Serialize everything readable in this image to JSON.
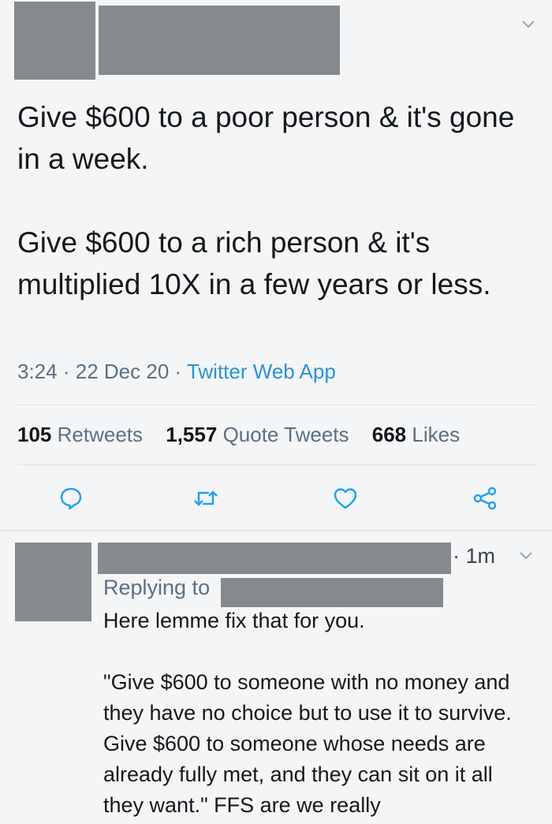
{
  "tweet": {
    "paragraphs": [
      "Give $600 to a poor person & it's gone in a week.",
      "Give $600 to a rich person & it's multiplied 10X in a few years or less."
    ],
    "time": "3:24",
    "date": "22 Dec 20",
    "source": "Twitter Web App",
    "dot": "·",
    "stats": {
      "retweets_count": "105",
      "retweets_label": "Retweets",
      "quotes_count": "1,557",
      "quotes_label": "Quote Tweets",
      "likes_count": "668",
      "likes_label": "Likes"
    }
  },
  "reply": {
    "time": "· 1m",
    "replying_label": "Replying to",
    "paragraphs": [
      "Here lemme fix that for you.",
      "\"Give $600 to someone with no money and they have no choice but to use it to survive. Give $600 to someone whose needs are already fully met, and they can sit on it all they want.\" FFS are we really"
    ]
  },
  "colors": {
    "redaction": "#868a8d",
    "link": "#2a93d8",
    "muted": "#5b7083",
    "icon": "#1da1f2"
  },
  "icons": [
    "reply-icon",
    "retweet-icon",
    "like-icon",
    "share-icon",
    "chevron-down-icon"
  ]
}
